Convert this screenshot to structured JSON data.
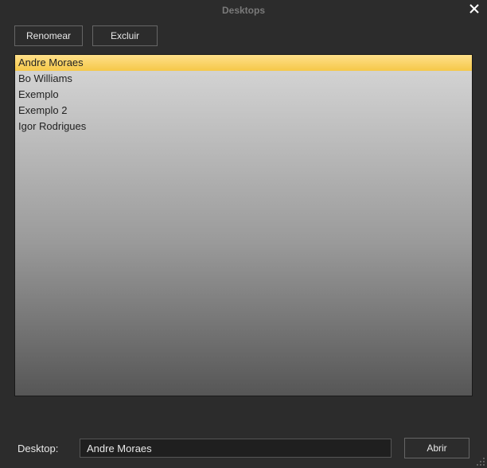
{
  "window": {
    "title": "Desktops"
  },
  "toolbar": {
    "rename_label": "Renomear",
    "delete_label": "Excluir"
  },
  "list": {
    "items": [
      {
        "label": "Andre Moraes",
        "selected": true
      },
      {
        "label": "Bo Williams",
        "selected": false
      },
      {
        "label": "Exemplo",
        "selected": false
      },
      {
        "label": "Exemplo 2",
        "selected": false
      },
      {
        "label": "Igor Rodrigues",
        "selected": false
      }
    ]
  },
  "footer": {
    "label": "Desktop:",
    "input_value": "Andre Moraes",
    "open_label": "Abrir"
  }
}
